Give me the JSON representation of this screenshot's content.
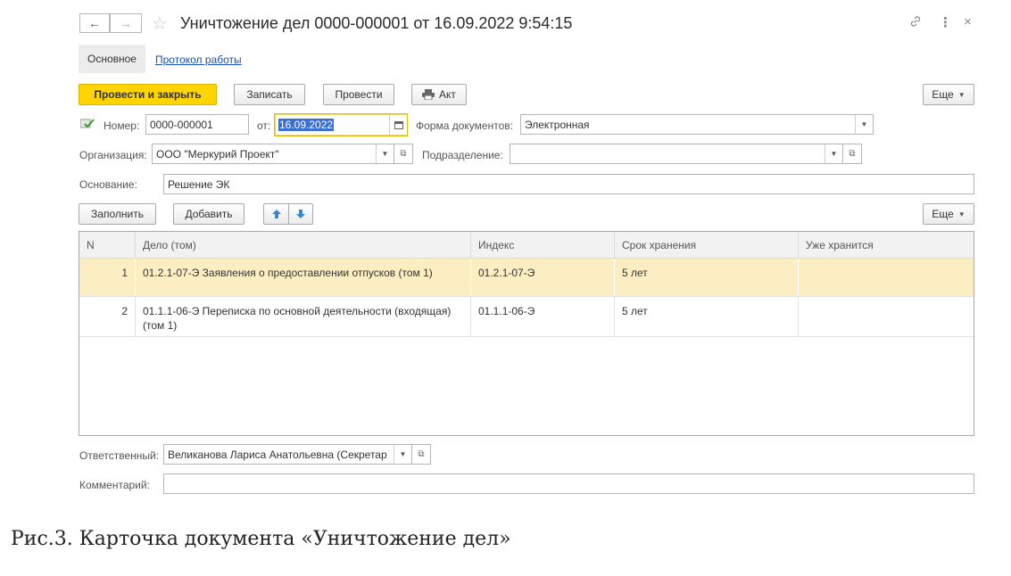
{
  "window": {
    "title": "Уничтожение дел 0000-000001 от 16.09.2022 9:54:15",
    "back_icon": "←",
    "forward_icon": "→",
    "star_icon": "☆",
    "link_icon": "🔗",
    "more_icon": "⋮",
    "close_icon": "×"
  },
  "tabs": [
    {
      "label": "Основное"
    },
    {
      "label": "Протокол работы"
    }
  ],
  "toolbar": {
    "post_close": "Провести и закрыть",
    "save": "Записать",
    "post": "Провести",
    "act": "Акт",
    "more": "Еще"
  },
  "form": {
    "number_label": "Номер:",
    "number_value": "0000-000001",
    "date_label": "от:",
    "date_value": "16.09.2022",
    "doc_form_label": "Форма документов:",
    "doc_form_value": "Электронная",
    "org_label": "Организация:",
    "org_value": "ООО \"Меркурий Проект\"",
    "division_label": "Подразделение:",
    "division_value": "",
    "basis_label": "Основание:",
    "basis_value": "Решение ЭК"
  },
  "table_toolbar": {
    "fill": "Заполнить",
    "add": "Добавить",
    "more": "Еще"
  },
  "table": {
    "columns": [
      "N",
      "Дело (том)",
      "Индекс",
      "Срок хранения",
      "Уже хранится"
    ],
    "rows": [
      {
        "n": "1",
        "case": "01.2.1-07-Э Заявления о предоставлении отпусков (том 1)",
        "index": "01.2.1-07-Э",
        "term": "5 лет",
        "stored": ""
      },
      {
        "n": "2",
        "case": "01.1.1-06-Э Переписка по основной деятельности (входящая) (том 1)",
        "index": "01.1.1-06-Э",
        "term": "5 лет",
        "stored": ""
      }
    ]
  },
  "footer": {
    "responsible_label": "Ответственный:",
    "responsible_value": "Великанова Лариса Анатольевна (Секретар",
    "comment_label": "Комментарий:",
    "comment_value": ""
  },
  "caption": "Рис.3. Карточка документа «Уничтожение дел»"
}
